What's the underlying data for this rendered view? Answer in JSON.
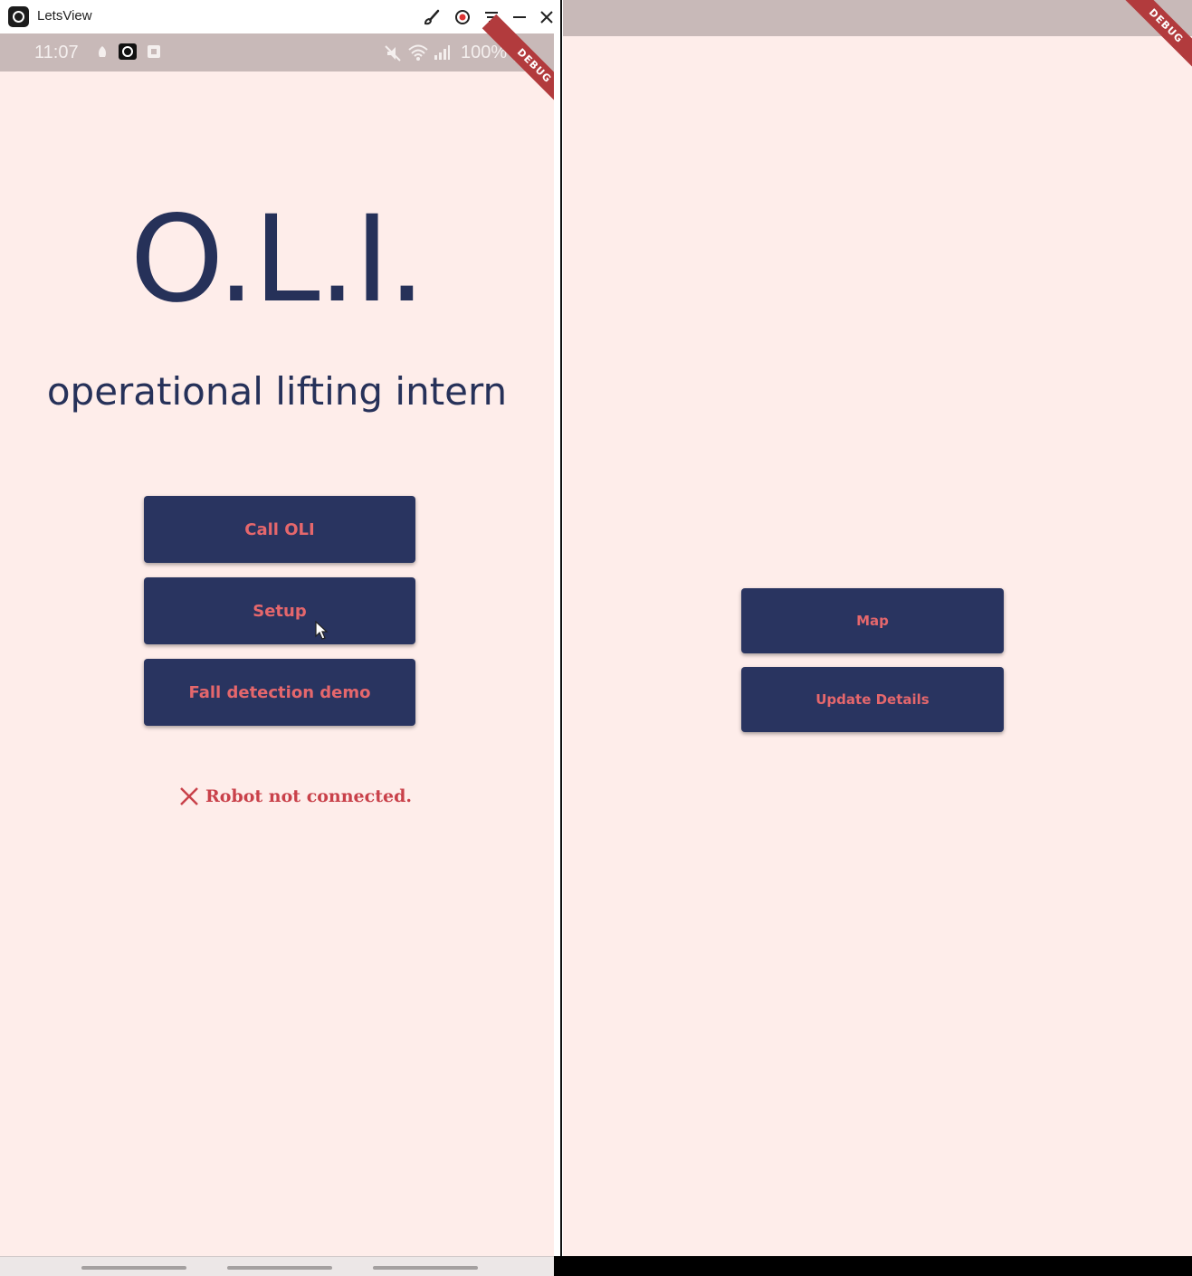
{
  "window": {
    "app_title": "LetsView",
    "toolbar_icons": [
      "brush-icon",
      "record-icon",
      "menu-icon",
      "minimize-icon",
      "close-icon"
    ]
  },
  "status_bar": {
    "time": "11:07",
    "battery": "100%",
    "icons": [
      "notification-icon",
      "camera-icon",
      "screenshot-icon",
      "mute-icon",
      "wifi-icon",
      "signal-icon",
      "battery-icon"
    ]
  },
  "debug_banner": "DEBUG",
  "home": {
    "logo": "O.L.I.",
    "tagline": "operational lifting intern",
    "buttons": {
      "call": "Call OLI",
      "setup": "Setup",
      "fall_detection": "Fall detection demo"
    },
    "connection_status": "Robot not connected."
  },
  "setup_page": {
    "buttons": {
      "map": "Map",
      "update_details": "Update Details"
    }
  },
  "colors": {
    "background": "#feedea",
    "primary": "#293460",
    "accent_text": "#e5676c",
    "error": "#c9414a",
    "debug": "#b23b3d"
  }
}
